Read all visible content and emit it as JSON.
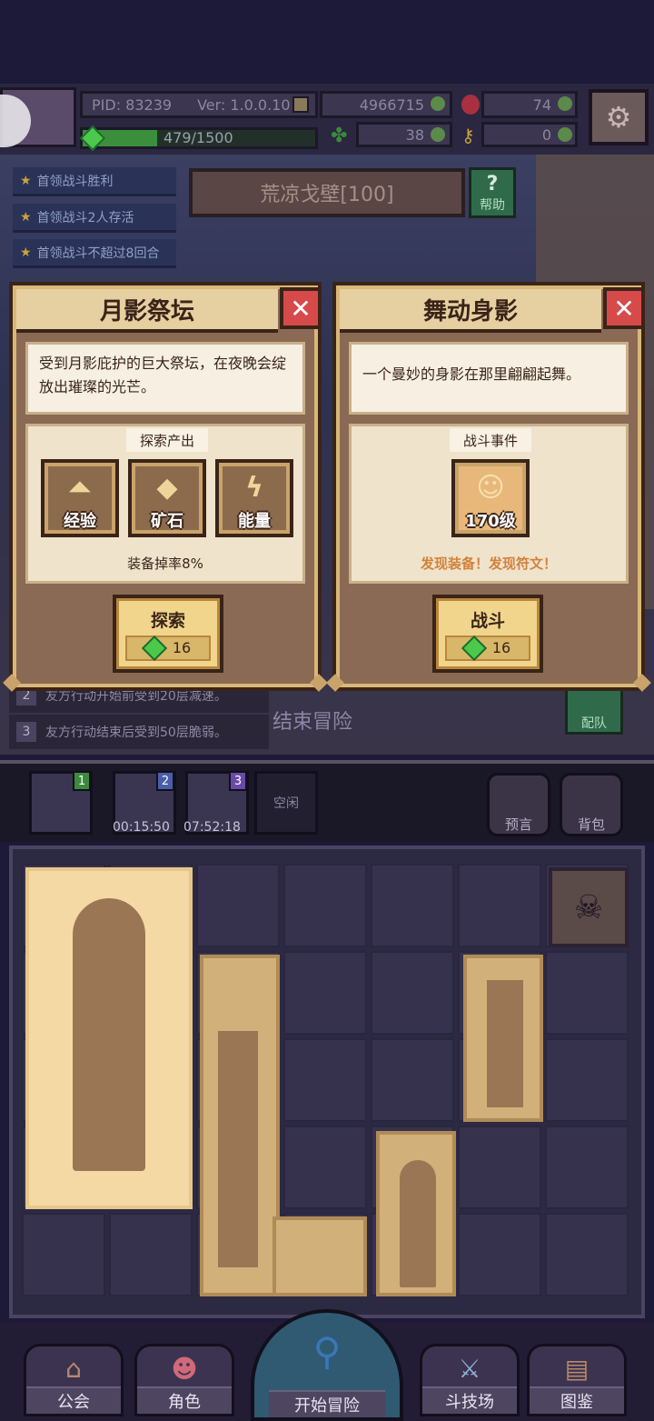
{
  "hud": {
    "pid": "PID: 83239",
    "version": "Ver: 1.0.0.10",
    "gold": "4966715",
    "ruby": "74",
    "exp": "479/1500",
    "exp_fraction": 0.32,
    "clover": "38",
    "key": "0"
  },
  "quests": [
    "首领战斗胜利",
    "首领战斗2人存活",
    "首领战斗不超过8回合"
  ],
  "stage_title": "荒凉戈壁[100]",
  "help_label": "帮助",
  "left_card": {
    "title": "月影祭坛",
    "description": "受到月影庇护的巨大祭坛，在夜晚会绽放出璀璨的光芒。",
    "panel_title": "探索产出",
    "rewards": [
      {
        "label": "经验",
        "icon": "exp-arrow-icon"
      },
      {
        "label": "矿石",
        "icon": "ore-icon"
      },
      {
        "label": "能量",
        "icon": "lightning-icon"
      }
    ],
    "drop_rate": "装备掉率8%",
    "action_label": "探索",
    "cost": "16"
  },
  "right_card": {
    "title": "舞动身影",
    "description": "一个曼妙的身影在那里翩翩起舞。",
    "panel_title": "战斗事件",
    "enemy_level": "170级",
    "discovery": "发现装备！发现符文！",
    "action_label": "战斗",
    "cost": "16"
  },
  "effects": [
    {
      "num": "2",
      "text": "友方行动开始前受到20层减速。"
    },
    {
      "num": "3",
      "text": "友方行动结束后受到50层脆弱。"
    }
  ],
  "end_label": "结束冒险",
  "team_label": "配队",
  "queue": {
    "slot_numbers": [
      "1",
      "2",
      "3"
    ],
    "timers": [
      "00:15:50",
      "07:52:18"
    ],
    "idle": "空闲"
  },
  "prophecy_label": "预言",
  "bag_label": "背包",
  "nav": {
    "guild": "公会",
    "character": "角色",
    "start": "开始冒险",
    "arena": "斗技场",
    "codex": "图鉴"
  }
}
